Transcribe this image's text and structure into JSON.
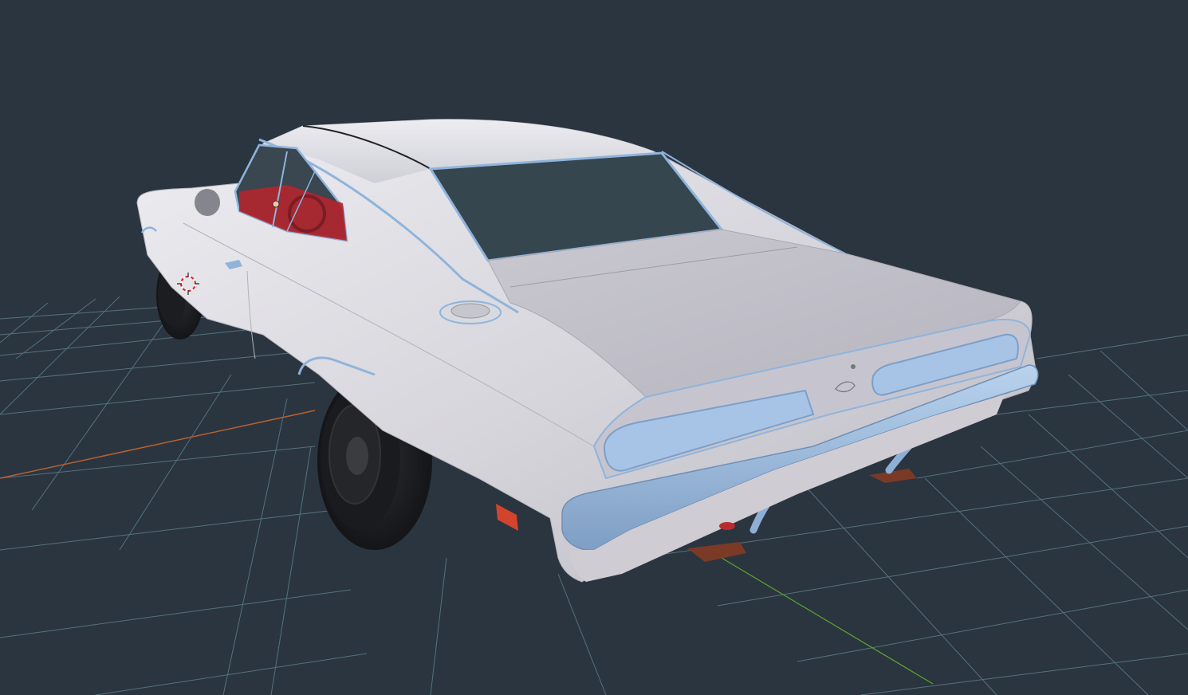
{
  "viewport": {
    "background": "#2a3540",
    "grid_color": "#5d7d84",
    "x_axis_color": "#b8602e",
    "y_axis_color": "#5aa82c",
    "car_body_color": "#d7d6dc",
    "car_trim_color": "#8fb4dc",
    "glass_color": "#36464f",
    "interior_color": "#b3252e",
    "tire_color": "#1d1f22",
    "marker_light_color": "#d2442c",
    "jack_stand_color": "#7a3a26"
  },
  "objects": [
    {
      "name": "car-body",
      "kind": "mesh"
    },
    {
      "name": "3d-cursor",
      "kind": "cursor"
    },
    {
      "name": "object-origin",
      "kind": "origin"
    }
  ]
}
